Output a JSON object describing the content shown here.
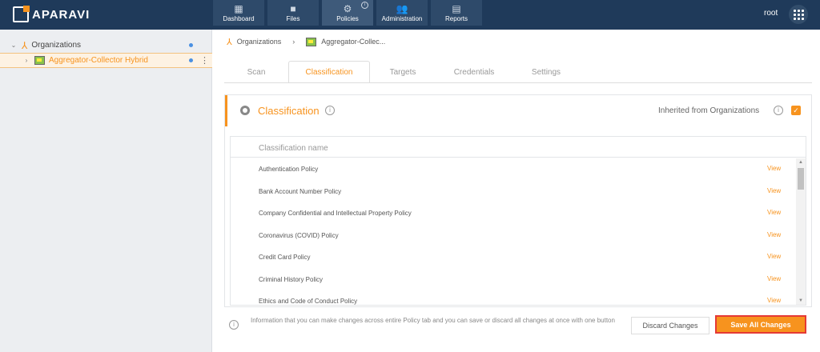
{
  "brand": {
    "name": "APARAVI"
  },
  "nav": [
    {
      "label": "Dashboard",
      "icon": "dashboard-icon"
    },
    {
      "label": "Files",
      "icon": "folder-icon"
    },
    {
      "label": "Policies",
      "icon": "gear-icon",
      "active": true
    },
    {
      "label": "Administration",
      "icon": "users-icon"
    },
    {
      "label": "Reports",
      "icon": "report-icon"
    }
  ],
  "user": {
    "name": "root"
  },
  "sidebar": {
    "items": [
      {
        "label": "Organizations"
      },
      {
        "label": "Aggregator-Collector Hybrid",
        "selected": true
      }
    ]
  },
  "breadcrumb": {
    "items": [
      "Organizations",
      "Aggregator-Collec..."
    ]
  },
  "tabs": [
    {
      "label": "Scan"
    },
    {
      "label": "Classification",
      "active": true
    },
    {
      "label": "Targets"
    },
    {
      "label": "Credentials"
    },
    {
      "label": "Settings"
    }
  ],
  "panel": {
    "title": "Classification",
    "inherit_label": "Inherited from Organizations",
    "inherit_checked": true
  },
  "table": {
    "header": "Classification name",
    "view_label": "View",
    "rows": [
      "Authentication Policy",
      "Bank Account Number Policy",
      "Company Confidential and Intellectual Property Policy",
      "Coronavirus (COVID) Policy",
      "Credit Card Policy",
      "Criminal History Policy",
      "Ethics and Code of Conduct Policy"
    ]
  },
  "footer": {
    "info_text": "Information that you can make changes across entire Policy tab and you can save or discard all changes at once with one button",
    "discard_label": "Discard Changes",
    "save_label": "Save All Changes"
  },
  "colors": {
    "accent": "#f7931e",
    "topbar": "#1f3a5a",
    "sidebar": "#eceef1"
  }
}
